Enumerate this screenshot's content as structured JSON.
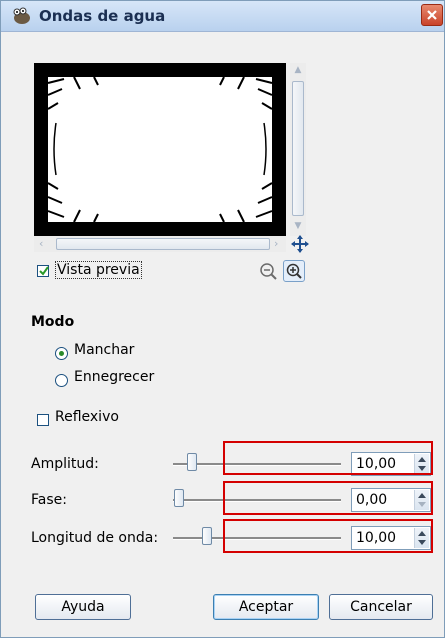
{
  "window": {
    "title": "Ondas de agua",
    "icon": "wilber-icon"
  },
  "preview": {
    "checkbox_label": "Vista previa",
    "checked": true,
    "zoom_out_icon": "zoom-out-icon",
    "zoom_in_icon": "zoom-in-icon",
    "nav_icon": "move-cross-icon"
  },
  "mode": {
    "title": "Modo",
    "options": [
      {
        "label": "Manchar",
        "selected": true
      },
      {
        "label": "Ennegrecer",
        "selected": false
      }
    ]
  },
  "reflexivo": {
    "label": "Reflexivo",
    "checked": false
  },
  "params": [
    {
      "label": "Amplitud:",
      "value": "10,00"
    },
    {
      "label": "Fase:",
      "value": "0,00"
    },
    {
      "label": "Longitud de onda:",
      "value": "10,00"
    }
  ],
  "buttons": {
    "help": "Ayuda",
    "ok": "Aceptar",
    "cancel": "Cancelar"
  },
  "colors": {
    "highlight": "#d40000",
    "titlebar": "#b9d1ee"
  }
}
